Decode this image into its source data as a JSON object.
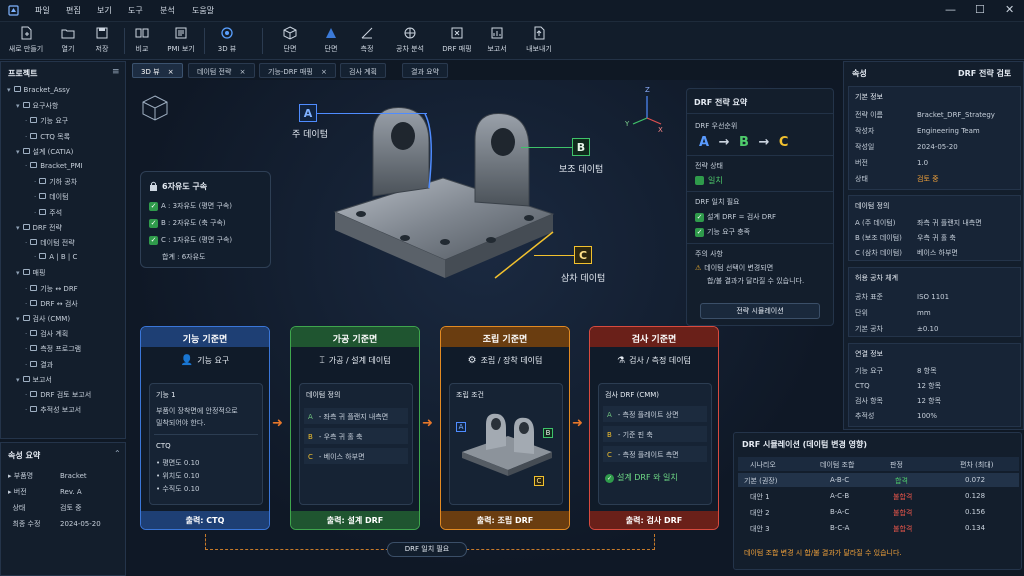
{
  "menu": [
    "파일",
    "편집",
    "보기",
    "도구",
    "분석",
    "도움말"
  ],
  "window_controls": [
    "—",
    "☐",
    "✕"
  ],
  "toolbar": [
    {
      "label": "새로 만들기",
      "icon": "new-file-icon"
    },
    {
      "label": "열기",
      "icon": "folder-icon"
    },
    {
      "label": "저장",
      "icon": "save-icon"
    },
    {
      "label": "비교",
      "icon": "compare-icon"
    },
    {
      "label": "PMI 보기",
      "icon": "pmi-icon"
    },
    {
      "label": "3D 뷰",
      "icon": "3d-view-icon"
    },
    {
      "label": "단면",
      "icon": "section-icon"
    },
    {
      "label": "단면",
      "icon": "section-plane-icon"
    },
    {
      "label": "측정",
      "icon": "measure-icon"
    },
    {
      "label": "공차 분석",
      "icon": "tolerance-icon"
    },
    {
      "label": "DRF 매핑",
      "icon": "drf-map-icon"
    },
    {
      "label": "보고서",
      "icon": "report-icon"
    },
    {
      "label": "내보내기",
      "icon": "export-icon"
    }
  ],
  "project": {
    "title": "프로젝트",
    "tree": [
      {
        "label": "Bracket_Assy",
        "level": 0
      },
      {
        "label": "요구사항",
        "level": 1
      },
      {
        "label": "기능 요구",
        "level": 2
      },
      {
        "label": "CTQ 목록",
        "level": 2
      },
      {
        "label": "설계 (CATIA)",
        "level": 1
      },
      {
        "label": "Bracket_PMI",
        "level": 2
      },
      {
        "label": "기하 공차",
        "level": 3
      },
      {
        "label": "데이텀",
        "level": 3
      },
      {
        "label": "주석",
        "level": 3
      },
      {
        "label": "DRF 전략",
        "level": 1
      },
      {
        "label": "데이텀 전략",
        "level": 2
      },
      {
        "label": "A | B | C",
        "level": 3
      },
      {
        "label": "매핑",
        "level": 1
      },
      {
        "label": "기능 ↔ DRF",
        "level": 2
      },
      {
        "label": "DRF ↔ 검사",
        "level": 2
      },
      {
        "label": "검사 (CMM)",
        "level": 1
      },
      {
        "label": "검사 계획",
        "level": 2
      },
      {
        "label": "측정 프로그램",
        "level": 2
      },
      {
        "label": "결과",
        "level": 2
      },
      {
        "label": "보고서",
        "level": 1
      },
      {
        "label": "DRF 검토 보고서",
        "level": 2
      },
      {
        "label": "추적성 보고서",
        "level": 2
      }
    ]
  },
  "props_summary": {
    "title": "속성 요약",
    "rows": [
      {
        "k": "부품명",
        "v": "Bracket"
      },
      {
        "k": "버전",
        "v": "Rev. A"
      },
      {
        "k": "상태",
        "v": "검토 중"
      },
      {
        "k": "최종 수정",
        "v": "2024-05-20"
      }
    ]
  },
  "tabs": [
    "3D 뷰",
    "데이텀 전략",
    "기능-DRF 매핑",
    "검사 계획",
    "결과 요약"
  ],
  "viewport": {
    "datum_a_letter": "A",
    "datum_a_label": "주 데이텀",
    "datum_b_letter": "B",
    "datum_b_label": "보조 데이텀",
    "datum_c_letter": "C",
    "datum_c_label": "삼차 데이텀",
    "axis_z": "Z",
    "axis_y": "Y",
    "axis_x": "X"
  },
  "dof": {
    "title": "6자유도 구속",
    "items": [
      "A : 3자유도 (평면 구속)",
      "B : 2자유도 (축 구속)",
      "C : 1자유도 (평면 구속)"
    ],
    "total": "합계 : 6자유도"
  },
  "drf_summary": {
    "title": "DRF 전략 요약",
    "priority_label": "DRF 우선순위",
    "seq": [
      "A",
      "→",
      "B",
      "→",
      "C"
    ],
    "status_label": "전략 상태",
    "status_value": "일치",
    "need_label": "DRF 일치 필요",
    "need_items": [
      "설계 DRF = 검사 DRF",
      "기능 요구 충족"
    ],
    "note_label": "주의 사항",
    "note_text1": "데이텀 선택이 변경되면",
    "note_text2": "합/불 결과가 달라질 수 있습니다.",
    "sim_button": "전략 시뮬레이션"
  },
  "flows": [
    {
      "header": "기능 기준면",
      "sub": "기능 요구",
      "footer": "출력: CTQ",
      "color": "#3a76d8",
      "inner_title": "기능 1",
      "inner_text1": "부품이 장착면에 안정적으로",
      "inner_text2": "밀착되어야 한다.",
      "ctq_title": "CTQ",
      "ctq_items": [
        "평면도 0.10",
        "위치도 0.10",
        "수직도 0.10"
      ]
    },
    {
      "header": "가공 기준면",
      "sub": "가공 / 설계 데이텀",
      "footer": "출력: 설계 DRF",
      "color": "#3fa64d",
      "inner_title": "데이텀 정의",
      "rows": [
        {
          "l": "A",
          "t": "- 좌측 귀 플랜지 내측면"
        },
        {
          "l": "B",
          "t": "- 우측 귀 홀 축"
        },
        {
          "l": "C",
          "t": "- 베이스 하부면"
        }
      ]
    },
    {
      "header": "조립 기준면",
      "sub": "조립 / 장착 데이텀",
      "footer": "출력: 조립 DRF",
      "color": "#e28a22",
      "inner_title": "조립 조건",
      "img_a": "A",
      "img_b": "B",
      "img_c": "C"
    },
    {
      "header": "검사 기준면",
      "sub": "검사 / 측정 데이텀",
      "footer": "출력: 검사 DRF",
      "color": "#d84a3e",
      "inner_title": "검사 DRF (CMM)",
      "rows": [
        {
          "l": "A",
          "t": "- 측정 플레이트 상면"
        },
        {
          "l": "B",
          "t": "- 기준 핀 축"
        },
        {
          "l": "C",
          "t": "- 측정 플레이트 측면"
        }
      ],
      "ok_text": "설계 DRF 와 일치"
    }
  ],
  "drf_match_label": "DRF 일치 필요",
  "right": {
    "title": "속성",
    "subtitle": "DRF 전략 검토",
    "basic": {
      "title": "기본 정보",
      "rows": [
        {
          "k": "전략 이름",
          "v": "Bracket_DRF_Strategy"
        },
        {
          "k": "작성자",
          "v": "Engineering Team"
        },
        {
          "k": "작성일",
          "v": "2024-05-20"
        },
        {
          "k": "버전",
          "v": "1.0"
        },
        {
          "k": "상태",
          "v": "검토 중"
        }
      ]
    },
    "datum": {
      "title": "데이텀 정의",
      "rows": [
        {
          "k": "A (주 데이텀)",
          "v": "좌측 귀 플랜지 내측면"
        },
        {
          "k": "B (보조 데이텀)",
          "v": "우측 귀 홀 축"
        },
        {
          "k": "C (삼차 데이텀)",
          "v": "베이스 하부면"
        }
      ]
    },
    "tol": {
      "title": "허용 공차 체계",
      "rows": [
        {
          "k": "공차 표준",
          "v": "ISO 1101"
        },
        {
          "k": "단위",
          "v": "mm"
        },
        {
          "k": "기본 공차",
          "v": "±0.10"
        }
      ]
    },
    "link": {
      "title": "연결 정보",
      "rows": [
        {
          "k": "기능 요구",
          "v": "8 항목"
        },
        {
          "k": "CTQ",
          "v": "12 항목"
        },
        {
          "k": "검사 항목",
          "v": "12 항목"
        },
        {
          "k": "추적성",
          "v": "100%"
        }
      ]
    }
  },
  "sim": {
    "title": "DRF 시뮬레이션 (데이텀 변경 영향)",
    "headers": [
      "시나리오",
      "데이텀 조합",
      "판정",
      "편차 (최대)"
    ],
    "rows": [
      {
        "s": "기본 (권장)",
        "c": "A-B-C",
        "r": "합격",
        "d": "0.072",
        "ok": true
      },
      {
        "s": "대안 1",
        "c": "A-C-B",
        "r": "불합격",
        "d": "0.128",
        "ok": false
      },
      {
        "s": "대안 2",
        "c": "B-A-C",
        "r": "불합격",
        "d": "0.156",
        "ok": false
      },
      {
        "s": "대안 3",
        "c": "B-C-A",
        "r": "불합격",
        "d": "0.134",
        "ok": false
      }
    ],
    "note": "데이텀 조합 변경 시 합/불 결과가 달라질 수 있습니다."
  }
}
